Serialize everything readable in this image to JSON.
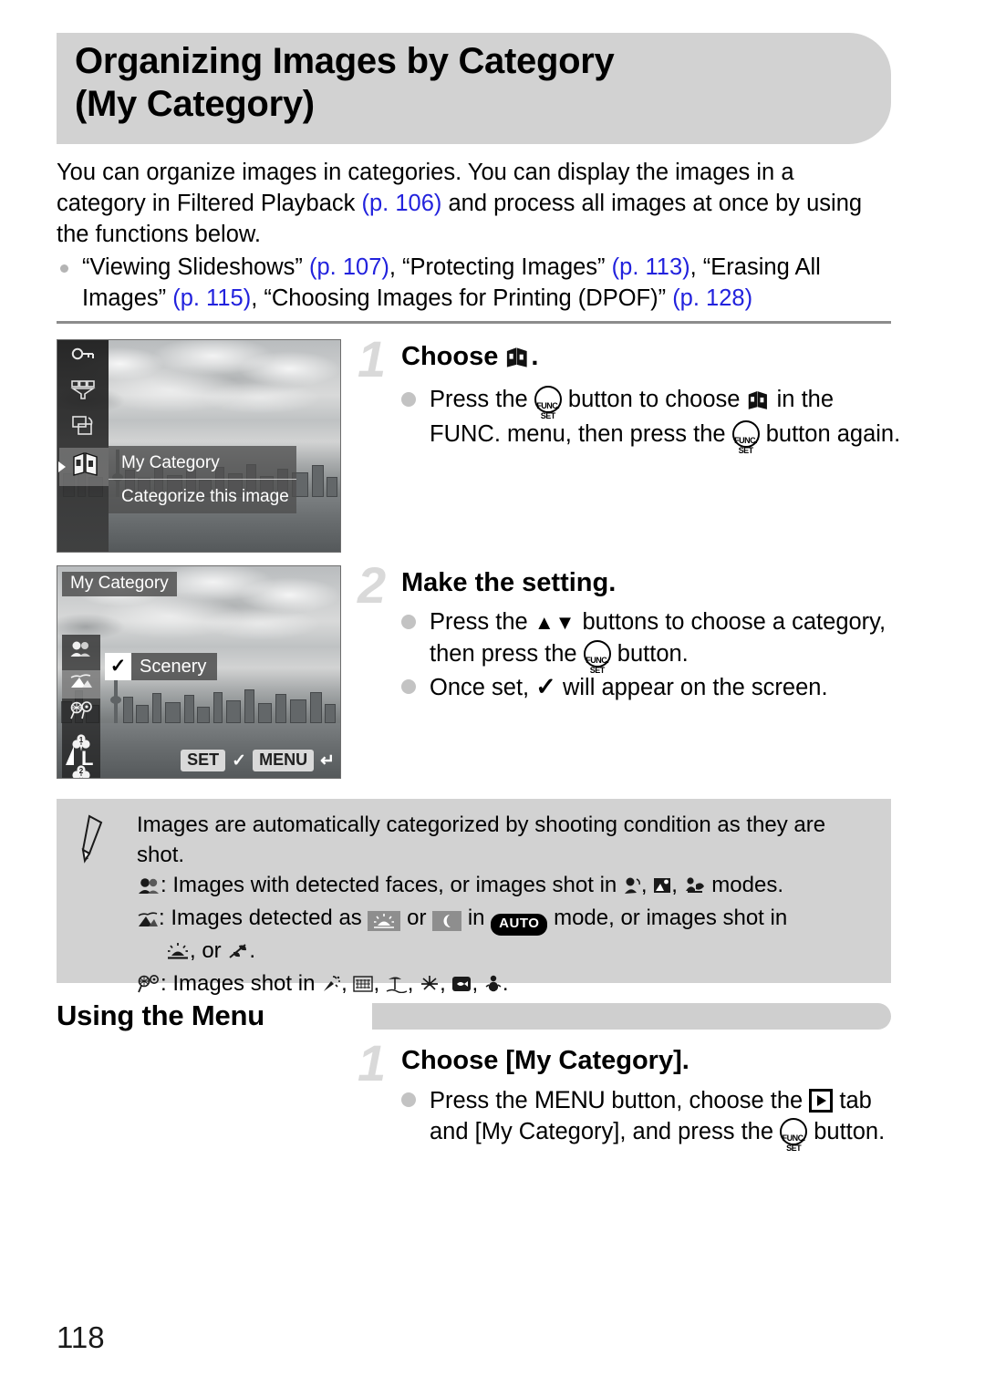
{
  "header": {
    "title_line1": "Organizing Images by Category",
    "title_line2": "(My Category)"
  },
  "intro": {
    "text_part1": "You can organize images in categories. You can display the images in a category in Filtered Playback ",
    "ref1": "(p. 106)",
    "text_part2": " and process all images at once by using the functions below."
  },
  "bullets": [
    {
      "seg1": "“Viewing Slideshows” ",
      "ref1": "(p. 107)",
      "seg2": ", “Protecting Images” ",
      "ref2": "(p. 113)",
      "seg3": ", “Erasing All Images” ",
      "ref3": "(p. 115)",
      "seg4": ", “Choosing Images for Printing (DPOF)” ",
      "ref4": "(p. 128)"
    }
  ],
  "lcd1": {
    "menu_row_1": "My Category",
    "menu_row_2": "Categorize this image",
    "rail_icons": [
      "protect-key-icon",
      "filter-playback-icon",
      "rotate-icon",
      "my-category-books-icon"
    ]
  },
  "lcd2": {
    "title": "My Category",
    "selected_option": "Scenery",
    "check_glyph": "✓",
    "quality_label": "L",
    "rail_icons": [
      "people-faces-icon",
      "scenery-icon",
      "events-icon",
      "category-1-icon",
      "category-2-icon",
      "scroll-down-arrow"
    ],
    "bottom_bar": {
      "set_label": "SET",
      "check_glyph": "✓",
      "menu_label": "MENU",
      "back_glyph": "↵"
    }
  },
  "steps": [
    {
      "number": "1",
      "title_prefix": "Choose ",
      "title_suffix": ".",
      "lines": [
        {
          "p1": "Press the ",
          "p2": " button to choose ",
          "p3": " in the FUNC. menu, then press the ",
          "p4": " button again."
        }
      ]
    },
    {
      "number": "2",
      "title": "Make the setting.",
      "lines": [
        {
          "p1": "Press the ",
          "arrows": "▲▼",
          "p2": " buttons to choose a category, then press the ",
          "p3": " button."
        },
        {
          "p1": "Once set, ",
          "check": "✓",
          "p2": " will appear on the screen."
        }
      ]
    },
    {
      "number": "1",
      "title": "Choose [My Category].",
      "lines": [
        {
          "p1": "Press the ",
          "menu_word": "MENU",
          "p2": " button, choose the ",
          "p3": " tab and [My Category], and press the ",
          "p4": " button."
        }
      ]
    }
  ],
  "note": {
    "line1": "Images are automatically categorized by shooting condition as they are shot.",
    "line2_pre": ": Images with detected faces, or images shot in ",
    "line2_post": " modes.",
    "line3_pre": ":  Images detected as ",
    "line3_or": " or ",
    "line3_mid": " in ",
    "auto_badge": "AUTO",
    "line3_post": " mode, or images shot in",
    "line4_mid": ", or ",
    "line4_end": ".",
    "line5_pre": ": Images shot in ",
    "line5_end": "."
  },
  "section": {
    "heading": "Using the Menu"
  },
  "footer": {
    "page_number": "118"
  },
  "colors": {
    "banner_gray": "#d2d2d2",
    "link_blue": "#2222dd",
    "step_number_gray": "#d9d9d9",
    "bullet_gray": "#c3c3c3"
  }
}
